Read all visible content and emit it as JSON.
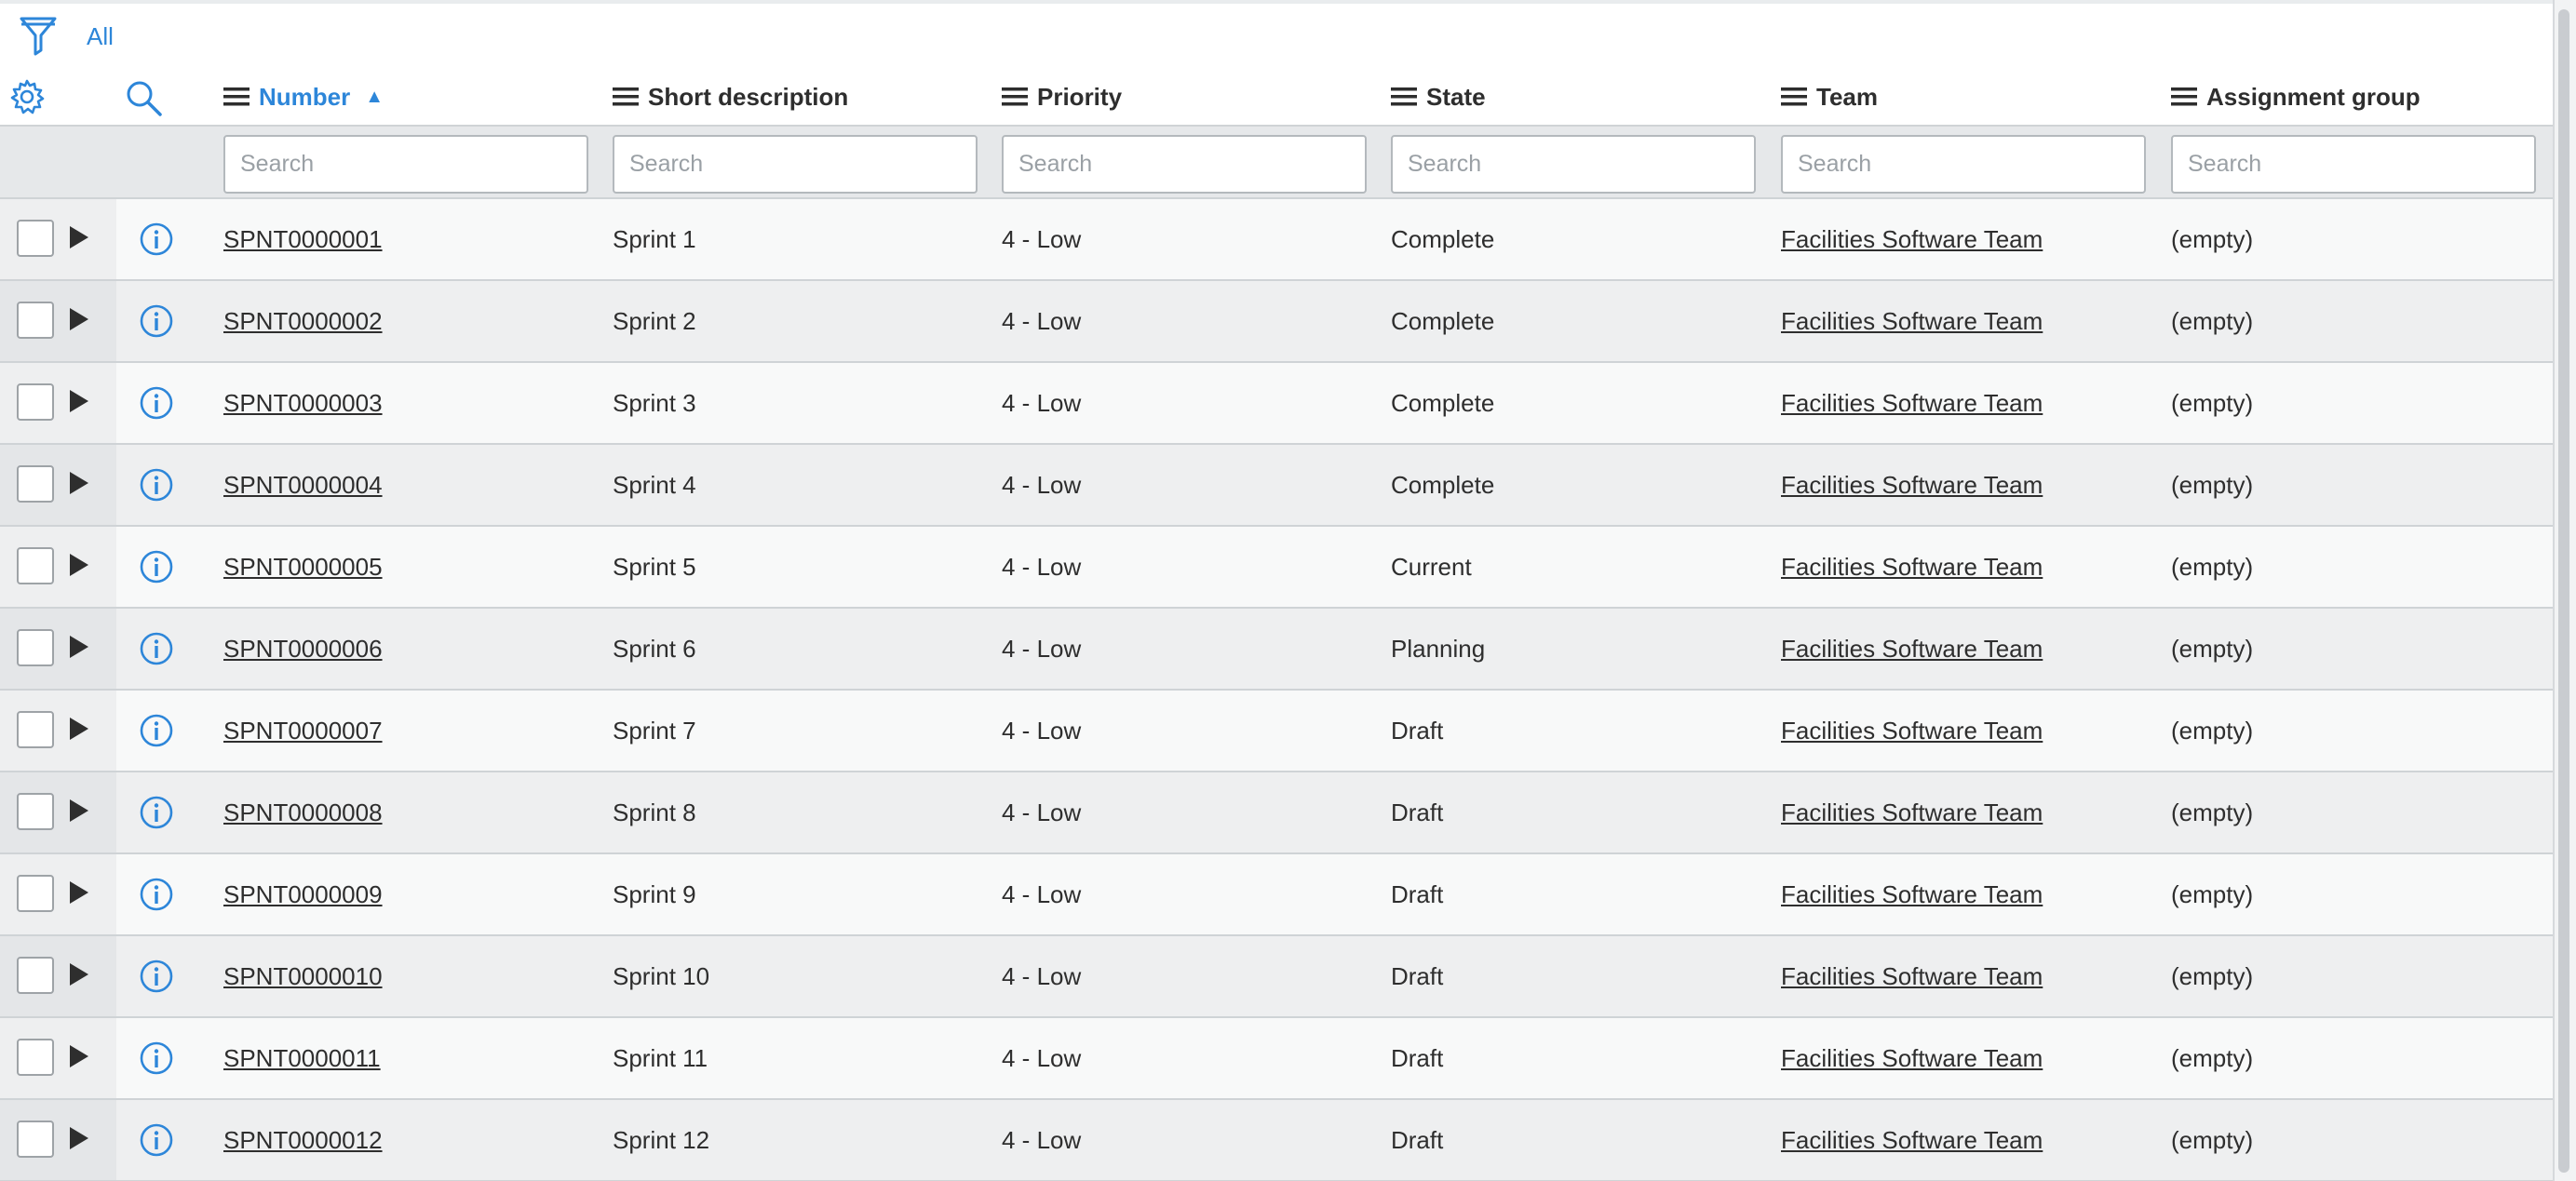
{
  "filter": {
    "label": "All"
  },
  "columns": [
    {
      "key": "number",
      "label": "Number",
      "sorted": "ascending"
    },
    {
      "key": "short_description",
      "label": "Short description"
    },
    {
      "key": "priority",
      "label": "Priority"
    },
    {
      "key": "state",
      "label": "State"
    },
    {
      "key": "team",
      "label": "Team"
    },
    {
      "key": "assignment_group",
      "label": "Assignment group"
    }
  ],
  "search_placeholder": "Search",
  "rows": [
    {
      "number": "SPNT0000001",
      "short_description": "Sprint 1",
      "priority": "4 - Low",
      "state": "Complete",
      "team": "Facilities Software Team",
      "assignment_group": "(empty)"
    },
    {
      "number": "SPNT0000002",
      "short_description": "Sprint 2",
      "priority": "4 - Low",
      "state": "Complete",
      "team": "Facilities Software Team",
      "assignment_group": "(empty)"
    },
    {
      "number": "SPNT0000003",
      "short_description": "Sprint 3",
      "priority": "4 - Low",
      "state": "Complete",
      "team": "Facilities Software Team",
      "assignment_group": "(empty)"
    },
    {
      "number": "SPNT0000004",
      "short_description": "Sprint 4",
      "priority": "4 - Low",
      "state": "Complete",
      "team": "Facilities Software Team",
      "assignment_group": "(empty)"
    },
    {
      "number": "SPNT0000005",
      "short_description": "Sprint 5",
      "priority": "4 - Low",
      "state": "Current",
      "team": "Facilities Software Team",
      "assignment_group": "(empty)"
    },
    {
      "number": "SPNT0000006",
      "short_description": "Sprint 6",
      "priority": "4 - Low",
      "state": "Planning",
      "team": "Facilities Software Team",
      "assignment_group": "(empty)"
    },
    {
      "number": "SPNT0000007",
      "short_description": "Sprint 7",
      "priority": "4 - Low",
      "state": "Draft",
      "team": "Facilities Software Team",
      "assignment_group": "(empty)"
    },
    {
      "number": "SPNT0000008",
      "short_description": "Sprint 8",
      "priority": "4 - Low",
      "state": "Draft",
      "team": "Facilities Software Team",
      "assignment_group": "(empty)"
    },
    {
      "number": "SPNT0000009",
      "short_description": "Sprint 9",
      "priority": "4 - Low",
      "state": "Draft",
      "team": "Facilities Software Team",
      "assignment_group": "(empty)"
    },
    {
      "number": "SPNT0000010",
      "short_description": "Sprint 10",
      "priority": "4 - Low",
      "state": "Draft",
      "team": "Facilities Software Team",
      "assignment_group": "(empty)"
    },
    {
      "number": "SPNT0000011",
      "short_description": "Sprint 11",
      "priority": "4 - Low",
      "state": "Draft",
      "team": "Facilities Software Team",
      "assignment_group": "(empty)"
    },
    {
      "number": "SPNT0000012",
      "short_description": "Sprint 12",
      "priority": "4 - Low",
      "state": "Draft",
      "team": "Facilities Software Team",
      "assignment_group": "(empty)"
    }
  ],
  "icons": {
    "filter": "filter-funnel-icon",
    "settings": "gear-icon",
    "search": "search-icon",
    "column_menu": "hamburger-menu-icon",
    "sort": "sort-ascending-icon",
    "expand": "play-triangle-icon",
    "info": "info-circle-icon"
  },
  "colors": {
    "accent": "#2d86d9",
    "text": "#2e2e2e",
    "row_odd": "#f8f9f9",
    "row_even": "#eeeff0",
    "search_row": "#e6e8ea"
  }
}
